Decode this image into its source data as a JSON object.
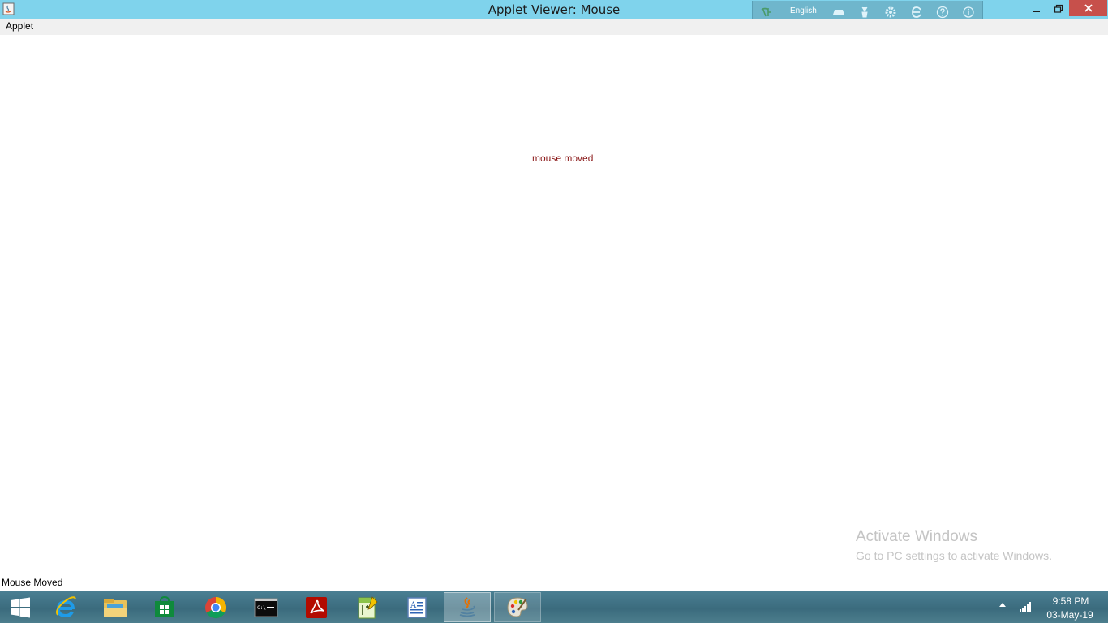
{
  "window": {
    "title": "Applet Viewer: Mouse"
  },
  "language_bar": {
    "language": "English",
    "icons": [
      "ime-mode-icon",
      "keyboard-icon",
      "ime-pad-icon",
      "settings-gear-icon",
      "dictionary-icon",
      "help-icon",
      "info-icon"
    ]
  },
  "menubar": {
    "items": [
      {
        "label": "Applet"
      }
    ]
  },
  "applet": {
    "message": "mouse moved",
    "message_color": "#8b1a1a"
  },
  "watermark": {
    "title": "Activate Windows",
    "subtitle": "Go to PC settings to activate Windows."
  },
  "statusbar": {
    "text": "Mouse Moved"
  },
  "taskbar": {
    "apps": [
      {
        "name": "windows-start-icon"
      },
      {
        "name": "internet-explorer-icon"
      },
      {
        "name": "file-explorer-icon"
      },
      {
        "name": "windows-store-icon"
      },
      {
        "name": "chrome-icon"
      },
      {
        "name": "command-prompt-icon"
      },
      {
        "name": "adobe-reader-icon"
      },
      {
        "name": "notepad-plus-plus-icon"
      },
      {
        "name": "wordpad-icon"
      },
      {
        "name": "java-icon"
      },
      {
        "name": "paint-icon"
      }
    ],
    "clock": {
      "time": "9:58 PM",
      "date": "03-May-19"
    }
  },
  "colors": {
    "title_bar": "#7fd3ec",
    "close_button": "#c7504b",
    "taskbar": "#3b6b7d"
  }
}
